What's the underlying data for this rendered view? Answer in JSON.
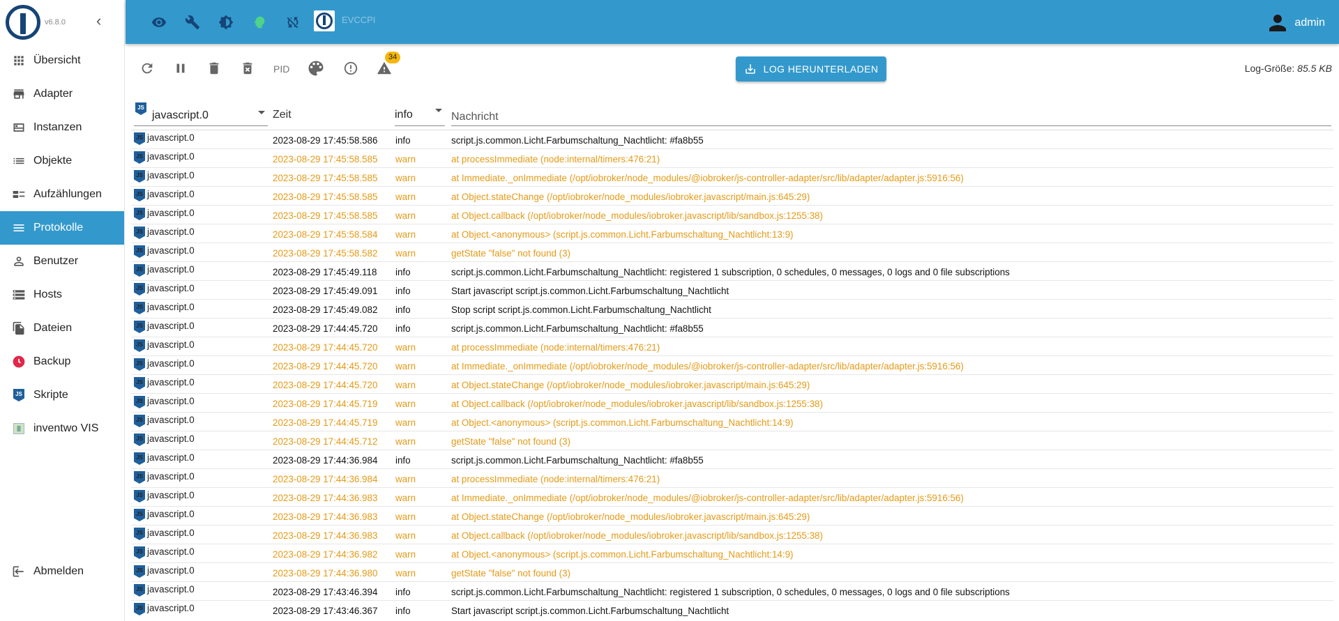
{
  "app": {
    "version": "v6.8.0",
    "host_name": "EVCCPI",
    "user": "admin"
  },
  "sidebar": {
    "items": [
      {
        "label": "Übersicht",
        "icon": "apps-icon"
      },
      {
        "label": "Adapter",
        "icon": "store-icon"
      },
      {
        "label": "Instanzen",
        "icon": "instances-icon"
      },
      {
        "label": "Objekte",
        "icon": "list-icon"
      },
      {
        "label": "Aufzählungen",
        "icon": "enum-icon"
      },
      {
        "label": "Protokolle",
        "icon": "menu-lines-icon",
        "active": true
      },
      {
        "label": "Benutzer",
        "icon": "person-icon"
      },
      {
        "label": "Hosts",
        "icon": "storage-icon"
      },
      {
        "label": "Dateien",
        "icon": "files-icon"
      },
      {
        "label": "Backup",
        "icon": "backup-icon"
      },
      {
        "label": "Skripte",
        "icon": "javascript-icon"
      },
      {
        "label": "inventwo VIS",
        "icon": "inventwo-icon"
      }
    ],
    "logout": "Abmelden"
  },
  "topbar": {
    "icons": [
      "eye-icon",
      "wrench-icon",
      "brightness-icon",
      "expert-mode-icon",
      "sync-off-icon"
    ]
  },
  "toolbar": {
    "pid_label": "PID",
    "warning_count": "34",
    "download_label": "LOG HERUNTERLADEN",
    "log_size_label": "Log-Größe:",
    "log_size_value": "85.5 KB"
  },
  "filters": {
    "adapter": "javascript.0",
    "time_header": "Zeit",
    "severity": "info",
    "message_placeholder": "Nachricht"
  },
  "colors": {
    "accent": "#3399cc",
    "warn": "#e59a17",
    "logo_blue": "#164477"
  },
  "logs": [
    {
      "src": "javascript.0",
      "time": "2023-08-29 17:45:58.586",
      "sev": "info",
      "msg": "script.js.common.Licht.Farbumschaltung_Nachtlicht: #fa8b55"
    },
    {
      "src": "javascript.0",
      "time": "2023-08-29 17:45:58.585",
      "sev": "warn",
      "msg": "at processImmediate (node:internal/timers:476:21)"
    },
    {
      "src": "javascript.0",
      "time": "2023-08-29 17:45:58.585",
      "sev": "warn",
      "msg": "at Immediate._onImmediate (/opt/iobroker/node_modules/@iobroker/js-controller-adapter/src/lib/adapter/adapter.js:5916:56)"
    },
    {
      "src": "javascript.0",
      "time": "2023-08-29 17:45:58.585",
      "sev": "warn",
      "msg": "at Object.stateChange (/opt/iobroker/node_modules/iobroker.javascript/main.js:645:29)"
    },
    {
      "src": "javascript.0",
      "time": "2023-08-29 17:45:58.585",
      "sev": "warn",
      "msg": "at Object.callback (/opt/iobroker/node_modules/iobroker.javascript/lib/sandbox.js:1255:38)"
    },
    {
      "src": "javascript.0",
      "time": "2023-08-29 17:45:58.584",
      "sev": "warn",
      "msg": "at Object.<anonymous> (script.js.common.Licht.Farbumschaltung_Nachtlicht:13:9)"
    },
    {
      "src": "javascript.0",
      "time": "2023-08-29 17:45:58.582",
      "sev": "warn",
      "msg": "getState \"false\" not found (3)"
    },
    {
      "src": "javascript.0",
      "time": "2023-08-29 17:45:49.118",
      "sev": "info",
      "msg": "script.js.common.Licht.Farbumschaltung_Nachtlicht: registered 1 subscription, 0 schedules, 0 messages, 0 logs and 0 file subscriptions"
    },
    {
      "src": "javascript.0",
      "time": "2023-08-29 17:45:49.091",
      "sev": "info",
      "msg": "Start javascript script.js.common.Licht.Farbumschaltung_Nachtlicht"
    },
    {
      "src": "javascript.0",
      "time": "2023-08-29 17:45:49.082",
      "sev": "info",
      "msg": "Stop script script.js.common.Licht.Farbumschaltung_Nachtlicht"
    },
    {
      "src": "javascript.0",
      "time": "2023-08-29 17:44:45.720",
      "sev": "info",
      "msg": "script.js.common.Licht.Farbumschaltung_Nachtlicht: #fa8b55"
    },
    {
      "src": "javascript.0",
      "time": "2023-08-29 17:44:45.720",
      "sev": "warn",
      "msg": "at processImmediate (node:internal/timers:476:21)"
    },
    {
      "src": "javascript.0",
      "time": "2023-08-29 17:44:45.720",
      "sev": "warn",
      "msg": "at Immediate._onImmediate (/opt/iobroker/node_modules/@iobroker/js-controller-adapter/src/lib/adapter/adapter.js:5916:56)"
    },
    {
      "src": "javascript.0",
      "time": "2023-08-29 17:44:45.720",
      "sev": "warn",
      "msg": "at Object.stateChange (/opt/iobroker/node_modules/iobroker.javascript/main.js:645:29)"
    },
    {
      "src": "javascript.0",
      "time": "2023-08-29 17:44:45.719",
      "sev": "warn",
      "msg": "at Object.callback (/opt/iobroker/node_modules/iobroker.javascript/lib/sandbox.js:1255:38)"
    },
    {
      "src": "javascript.0",
      "time": "2023-08-29 17:44:45.719",
      "sev": "warn",
      "msg": "at Object.<anonymous> (script.js.common.Licht.Farbumschaltung_Nachtlicht:14:9)"
    },
    {
      "src": "javascript.0",
      "time": "2023-08-29 17:44:45.712",
      "sev": "warn",
      "msg": "getState \"false\" not found (3)"
    },
    {
      "src": "javascript.0",
      "time": "2023-08-29 17:44:36.984",
      "sev": "info",
      "msg": "script.js.common.Licht.Farbumschaltung_Nachtlicht: #fa8b55"
    },
    {
      "src": "javascript.0",
      "time": "2023-08-29 17:44:36.984",
      "sev": "warn",
      "msg": "at processImmediate (node:internal/timers:476:21)"
    },
    {
      "src": "javascript.0",
      "time": "2023-08-29 17:44:36.983",
      "sev": "warn",
      "msg": "at Immediate._onImmediate (/opt/iobroker/node_modules/@iobroker/js-controller-adapter/src/lib/adapter/adapter.js:5916:56)"
    },
    {
      "src": "javascript.0",
      "time": "2023-08-29 17:44:36.983",
      "sev": "warn",
      "msg": "at Object.stateChange (/opt/iobroker/node_modules/iobroker.javascript/main.js:645:29)"
    },
    {
      "src": "javascript.0",
      "time": "2023-08-29 17:44:36.983",
      "sev": "warn",
      "msg": "at Object.callback (/opt/iobroker/node_modules/iobroker.javascript/lib/sandbox.js:1255:38)"
    },
    {
      "src": "javascript.0",
      "time": "2023-08-29 17:44:36.982",
      "sev": "warn",
      "msg": "at Object.<anonymous> (script.js.common.Licht.Farbumschaltung_Nachtlicht:14:9)"
    },
    {
      "src": "javascript.0",
      "time": "2023-08-29 17:44:36.980",
      "sev": "warn",
      "msg": "getState \"false\" not found (3)"
    },
    {
      "src": "javascript.0",
      "time": "2023-08-29 17:43:46.394",
      "sev": "info",
      "msg": "script.js.common.Licht.Farbumschaltung_Nachtlicht: registered 1 subscription, 0 schedules, 0 messages, 0 logs and 0 file subscriptions"
    },
    {
      "src": "javascript.0",
      "time": "2023-08-29 17:43:46.367",
      "sev": "info",
      "msg": "Start javascript script.js.common.Licht.Farbumschaltung_Nachtlicht"
    }
  ]
}
